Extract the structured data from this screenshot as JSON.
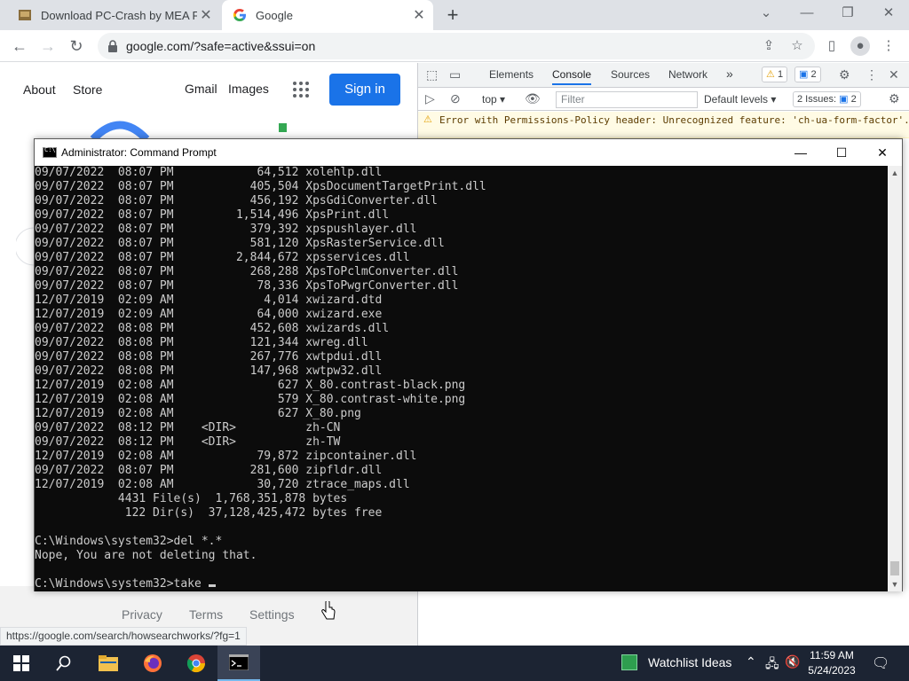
{
  "browser": {
    "tabs": [
      {
        "title": "Download PC-Crash by MEA Fore",
        "active": false
      },
      {
        "title": "Google",
        "active": true
      }
    ],
    "new_tab": "+",
    "url": "google.com/?safe=active&ssui=on"
  },
  "google": {
    "about": "About",
    "store": "Store",
    "gmail": "Gmail",
    "images": "Images",
    "sign_in": "Sign in",
    "footer": {
      "privacy": "Privacy",
      "terms": "Terms",
      "settings": "Settings"
    },
    "status_url": "https://google.com/search/howsearchworks/?fg=1"
  },
  "devtools": {
    "tabs": [
      "Elements",
      "Console",
      "Sources",
      "Network"
    ],
    "active_tab": "Console",
    "more": "»",
    "warnings_count": "1",
    "messages_count": "2",
    "context": "top",
    "filter_placeholder": "Filter",
    "levels": "Default levels",
    "issues_label": "2 Issues:",
    "issues_count": "2",
    "warning_text": "Error with Permissions-Policy header: Unrecognized feature: 'ch-ua-form-factor'."
  },
  "cmd": {
    "title": "Administrator: Command Prompt",
    "lines": [
      "09/07/2022  08:07 PM            64,512 xolehlp.dll",
      "09/07/2022  08:07 PM           405,504 XpsDocumentTargetPrint.dll",
      "09/07/2022  08:07 PM           456,192 XpsGdiConverter.dll",
      "09/07/2022  08:07 PM         1,514,496 XpsPrint.dll",
      "09/07/2022  08:07 PM           379,392 xpspushlayer.dll",
      "09/07/2022  08:07 PM           581,120 XpsRasterService.dll",
      "09/07/2022  08:07 PM         2,844,672 xpsservices.dll",
      "09/07/2022  08:07 PM           268,288 XpsToPclmConverter.dll",
      "09/07/2022  08:07 PM            78,336 XpsToPwgrConverter.dll",
      "12/07/2019  02:09 AM             4,014 xwizard.dtd",
      "12/07/2019  02:09 AM            64,000 xwizard.exe",
      "09/07/2022  08:08 PM           452,608 xwizards.dll",
      "09/07/2022  08:08 PM           121,344 xwreg.dll",
      "09/07/2022  08:08 PM           267,776 xwtpdui.dll",
      "09/07/2022  08:08 PM           147,968 xwtpw32.dll",
      "12/07/2019  02:08 AM               627 X_80.contrast-black.png",
      "12/07/2019  02:08 AM               579 X_80.contrast-white.png",
      "12/07/2019  02:08 AM               627 X_80.png",
      "09/07/2022  08:12 PM    <DIR>          zh-CN",
      "09/07/2022  08:12 PM    <DIR>          zh-TW",
      "12/07/2019  02:08 AM            79,872 zipcontainer.dll",
      "09/07/2022  08:07 PM           281,600 zipfldr.dll",
      "12/07/2019  02:08 AM            30,720 ztrace_maps.dll",
      "            4431 File(s)  1,768,351,878 bytes",
      "             122 Dir(s)  37,128,425,472 bytes free",
      "",
      "C:\\Windows\\system32>del *.*",
      "Nope, You are not deleting that.",
      ""
    ],
    "prompt_line": "C:\\Windows\\system32>take "
  },
  "taskbar": {
    "watchlist": "Watchlist Ideas",
    "time": "11:59 AM",
    "date": "5/24/2023"
  },
  "colors": {
    "chrome_tabstrip": "#dee1e6",
    "signin_blue": "#1a73e8",
    "console_bg": "#0c0c0c",
    "taskbar_bg": "#1c2433"
  }
}
